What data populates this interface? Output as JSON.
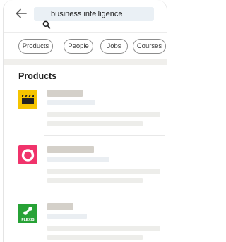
{
  "search": {
    "query": "business intelligence"
  },
  "filters": [
    "Products",
    "People",
    "Jobs",
    "Courses"
  ],
  "section": {
    "title": "Products"
  },
  "results": [
    {
      "logo": "film-clapper-logo",
      "logo_color": "#f5c400"
    },
    {
      "logo": "ring-logo",
      "logo_color": "#f0336b"
    },
    {
      "logo": "flexis-logo",
      "logo_color": "#27a236",
      "logo_text": "FLEXIS"
    }
  ]
}
